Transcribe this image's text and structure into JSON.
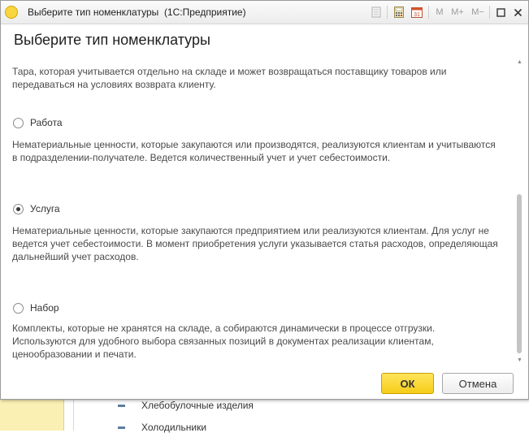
{
  "background": {
    "list_items": [
      "Хлебобулочные изделия",
      "Холодильники"
    ]
  },
  "window": {
    "title": "Выберите тип номенклатуры",
    "app_name": "(1С:Предприятие)",
    "app_icon_text": "1С",
    "toolbar": {
      "m": "M",
      "m_plus": "M+",
      "m_minus": "M−",
      "calculator_icon": "calculator-icon",
      "calendar_icon": "calendar-icon",
      "calendar_day": "31",
      "restore_icon": "restore-icon",
      "close_icon": "close-icon"
    }
  },
  "dialog": {
    "header": "Выберите тип номенклатуры",
    "options": [
      {
        "label": "",
        "checked": false,
        "description": "Тара, которая учитывается отдельно на складе и может возвращаться поставщику товаров или передаваться на условиях возврата клиенту."
      },
      {
        "label": "Работа",
        "checked": false,
        "description": "Нематериальные ценности, которые закупаются или производятся, реализуются клиентам и учитываются в подразделении-получателе. Ведется количественный учет и учет себестоимости."
      },
      {
        "label": "Услуга",
        "checked": true,
        "description": "Нематериальные ценности, которые закупаются предприятием или реализуются клиентам. Для услуг не ведется учет себестоимости. В момент приобретения услуги указывается статья расходов, определяющая дальнейший учет расходов."
      },
      {
        "label": "Набор",
        "checked": false,
        "description": "Комплекты, которые не хранятся на складе, а собираются динамически в процессе отгрузки. Используются для удобного выбора связанных позиций в документах реализации клиентам, ценообразовании и печати."
      }
    ],
    "ok_label": "ОК",
    "cancel_label": "Отмена"
  },
  "colors": {
    "ok_button": "#f5cd18",
    "background_panel": "#fbf0b4",
    "bullet": "#5b7f9e"
  }
}
